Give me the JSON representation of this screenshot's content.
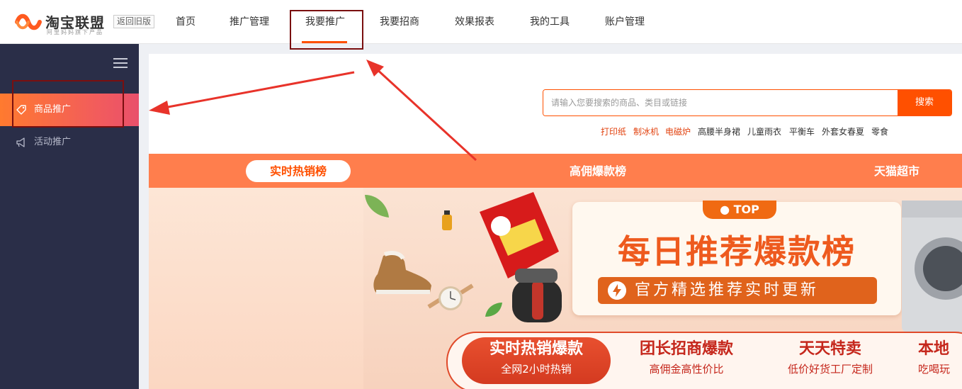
{
  "header": {
    "logo_title": "淘宝联盟",
    "logo_sub": "阿里妈妈旗下产品",
    "back_old": "返回旧版",
    "nav": [
      "首页",
      "推广管理",
      "我要推广",
      "我要招商",
      "效果报表",
      "我的工具",
      "账户管理"
    ],
    "active_nav": "我要推广"
  },
  "sidebar": {
    "items": [
      {
        "label": "商品推广",
        "icon": "tag-icon",
        "active": true
      },
      {
        "label": "活动推广",
        "icon": "megaphone-icon",
        "active": false
      }
    ]
  },
  "search": {
    "placeholder": "请输入您要搜索的商品、类目或链接",
    "value": "",
    "button": "搜索",
    "hotwords": [
      {
        "label": "打印纸",
        "hot": true
      },
      {
        "label": "制冰机",
        "hot": true
      },
      {
        "label": "电磁炉",
        "hot": true
      },
      {
        "label": "高腰半身裙",
        "hot": false
      },
      {
        "label": "儿童雨衣",
        "hot": false
      },
      {
        "label": "平衡车",
        "hot": false
      },
      {
        "label": "外套女春夏",
        "hot": false
      },
      {
        "label": "零食",
        "hot": false
      }
    ]
  },
  "tabs": [
    "实时热销榜",
    "高佣爆款榜",
    "天猫超市"
  ],
  "banner": {
    "badge": "TOP",
    "title": "每日推荐爆款榜",
    "subtitle": "官方精选推荐实时更新",
    "pills": [
      {
        "title": "实时热销爆款",
        "sub": "全网2小时热销",
        "active": true
      },
      {
        "title": "团长招商爆款",
        "sub": "高佣金高性价比",
        "active": false
      },
      {
        "title": "天天特卖",
        "sub": "低价好货工厂定制",
        "active": false
      },
      {
        "title": "本地",
        "sub": "吃喝玩",
        "active": false
      }
    ]
  },
  "colors": {
    "brand": "#ff5000",
    "sidebar_bg": "#2a2e48",
    "annotation": "#7a0f0f",
    "arrow": "#e8332a"
  }
}
